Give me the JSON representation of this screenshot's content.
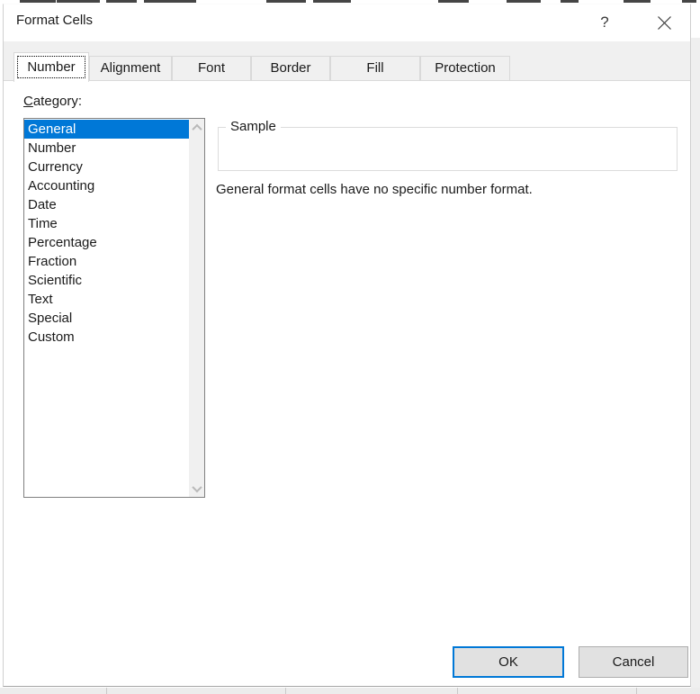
{
  "window": {
    "title": "Format Cells",
    "help_icon": "?"
  },
  "tabs": [
    "Number",
    "Alignment",
    "Font",
    "Border",
    "Fill",
    "Protection"
  ],
  "active_tab": "Number",
  "number_tab": {
    "category_label_accesskey": "C",
    "category_label_rest": "ategory:",
    "categories": [
      "General",
      "Number",
      "Currency",
      "Accounting",
      "Date",
      "Time",
      "Percentage",
      "Fraction",
      "Scientific",
      "Text",
      "Special",
      "Custom"
    ],
    "selected_category": "General",
    "sample_legend": "Sample",
    "sample_value": "",
    "description": "General format cells have no specific number format."
  },
  "footer": {
    "ok_label": "OK",
    "cancel_label": "Cancel"
  },
  "colors": {
    "selection_blue": "#0078d7",
    "ok_focus_border": "#0078d7",
    "button_face": "#e1e1e1",
    "cancel_border": "#adadad",
    "tab_border": "#d9d9d9",
    "strip_bg": "#f0f0f0",
    "dialog_bg": "#ffffff"
  }
}
